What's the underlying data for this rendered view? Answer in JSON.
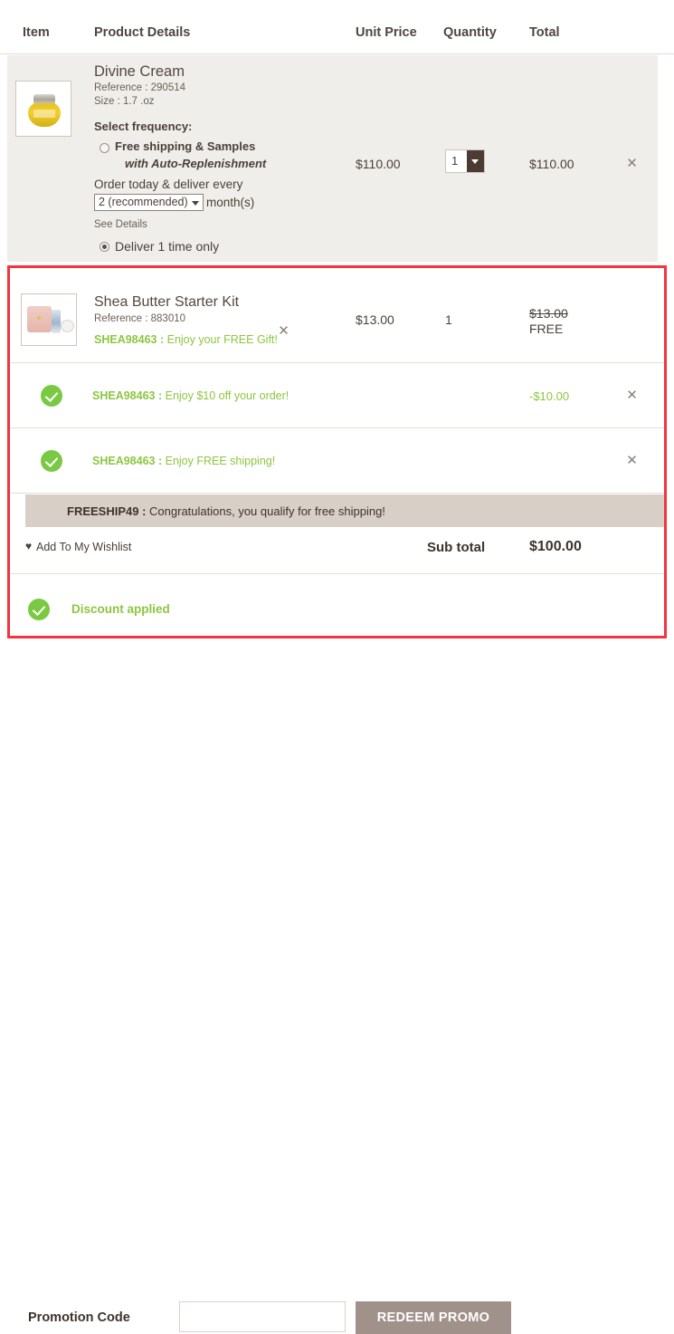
{
  "table_header": {
    "item": "Item",
    "product_details": "Product Details",
    "unit_price": "Unit Price",
    "quantity": "Quantity",
    "total": "Total"
  },
  "products": [
    {
      "name": "Divine Cream",
      "reference": "Reference : 290514",
      "size": "Size : 1.7 .oz",
      "thumbnail_icon": "cream-jar-image",
      "frequency": {
        "label": "Select frequency:",
        "auto_option": "Free shipping & Samples",
        "auto_option_sub": "with Auto-Replenishment",
        "auto_selected": false,
        "order_line": "Order today & deliver every",
        "interval_value": "2 (recommended)",
        "months_suffix": "month(s)",
        "see_details": "See Details",
        "once_option": "Deliver 1 time only",
        "once_selected": true
      },
      "unit_price": "$110.00",
      "quantity": "1",
      "total": "$110.00",
      "remove_icon": "close-icon"
    },
    {
      "name": "Shea Butter Starter Kit",
      "reference": "Reference : 883010",
      "thumbnail_icon": "starter-kit-image",
      "promo_code": "SHEA98463 :",
      "promo_message": "Enjoy your FREE Gift!",
      "unit_price": "$13.00",
      "quantity": "1",
      "total_original": "$13.00",
      "total_free": "FREE",
      "remove_icon": "close-icon"
    }
  ],
  "discounts": [
    {
      "status_icon": "green-check-icon",
      "code": "SHEA98463 :",
      "message": "Enjoy $10 off your order!",
      "amount": "-$10.00",
      "remove_icon": "close-icon"
    },
    {
      "status_icon": "green-check-icon",
      "code": "SHEA98463 :",
      "message": "Enjoy FREE shipping!",
      "amount": "",
      "remove_icon": "close-icon"
    }
  ],
  "freeship_banner": {
    "code": "FREESHIP49 :",
    "message": "Congratulations, you qualify for free shipping!"
  },
  "wishlist": {
    "icon": "heart-icon",
    "label": "Add To My Wishlist"
  },
  "subtotal": {
    "label": "Sub total",
    "value": "$100.00"
  },
  "discount_applied": {
    "status_icon": "green-check-icon",
    "label": "Discount applied"
  },
  "promotion": {
    "label": "Promotion Code",
    "input_value": "",
    "input_placeholder": "",
    "button_label": "REDEEM PROMO"
  },
  "colors": {
    "highlight_border": "#f5333f",
    "promo_green": "#8cc63f",
    "row_beige": "#f0eeea",
    "banner_tan": "#d8cfc7",
    "redeem_button": "#a1918b",
    "qty_button": "#4c3b32"
  }
}
